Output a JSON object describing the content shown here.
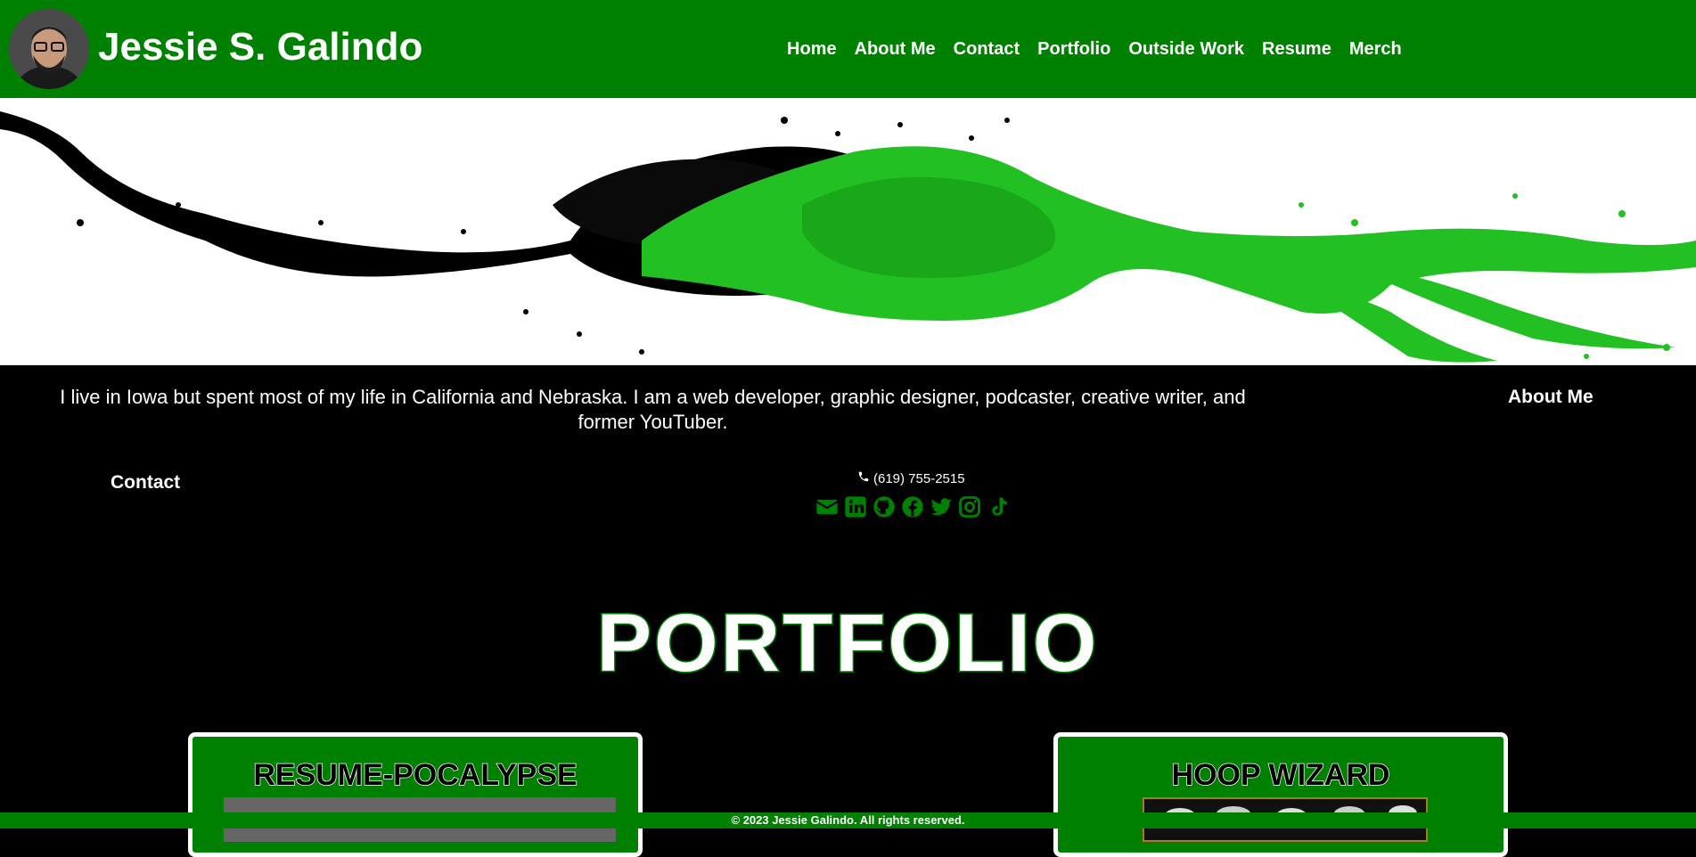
{
  "header": {
    "site_title": "Jessie S. Galindo",
    "nav": [
      "Home",
      "About Me",
      "Contact",
      "Portfolio",
      "Outside Work",
      "Resume",
      "Merch"
    ]
  },
  "about": {
    "text": "I live in Iowa but spent most of my life in California and Nebraska. I am a web developer, graphic designer, podcaster, creative writer, and former YouTuber.",
    "heading": "About Me"
  },
  "contact": {
    "heading": "Contact",
    "phone": "(619) 755-2515",
    "social_icons": [
      "email-icon",
      "linkedin-icon",
      "github-icon",
      "facebook-icon",
      "twitter-icon",
      "instagram-icon",
      "tiktok-icon"
    ]
  },
  "portfolio": {
    "title": "PORTFOLIO",
    "cards": [
      {
        "title": "RESUME-POCALYPSE"
      },
      {
        "title": "HOOP WIZARD"
      }
    ]
  },
  "footer": {
    "text": "© 2023 Jessie Galindo. All rights reserved."
  },
  "colors": {
    "brand_green": "#008000",
    "bright_green": "#22cc22",
    "background": "#000000",
    "text": "#ffffff"
  }
}
